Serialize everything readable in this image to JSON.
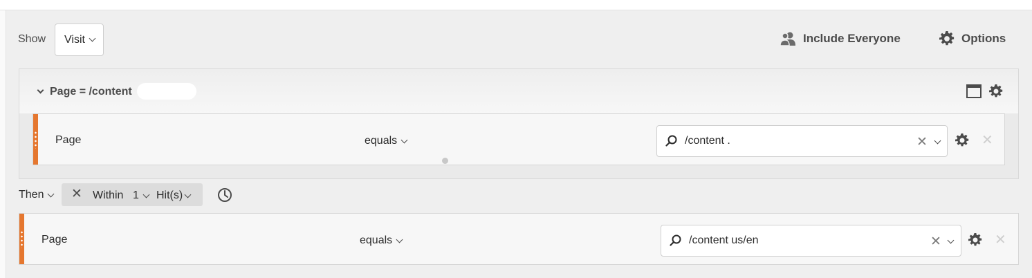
{
  "toolbar": {
    "show_label": "Show",
    "show_value": "Visit",
    "include_everyone": "Include Everyone",
    "options": "Options"
  },
  "container": {
    "title": "Page = /content"
  },
  "rules": [
    {
      "dimension": "Page",
      "operator": "equals",
      "value": "/content                   .",
      "accent": "#e5772f"
    },
    {
      "dimension": "Page",
      "operator": "equals",
      "value": "/content                     us/en",
      "accent": "#e5772f"
    }
  ],
  "sequence": {
    "then_label": "Then",
    "within_label": "Within",
    "count": "1",
    "unit": "Hit(s)"
  },
  "icons": [
    "chevron-down-icon",
    "user-group-icon",
    "gear-icon",
    "window-icon",
    "search-icon",
    "clear-icon",
    "close-icon",
    "clock-icon"
  ]
}
